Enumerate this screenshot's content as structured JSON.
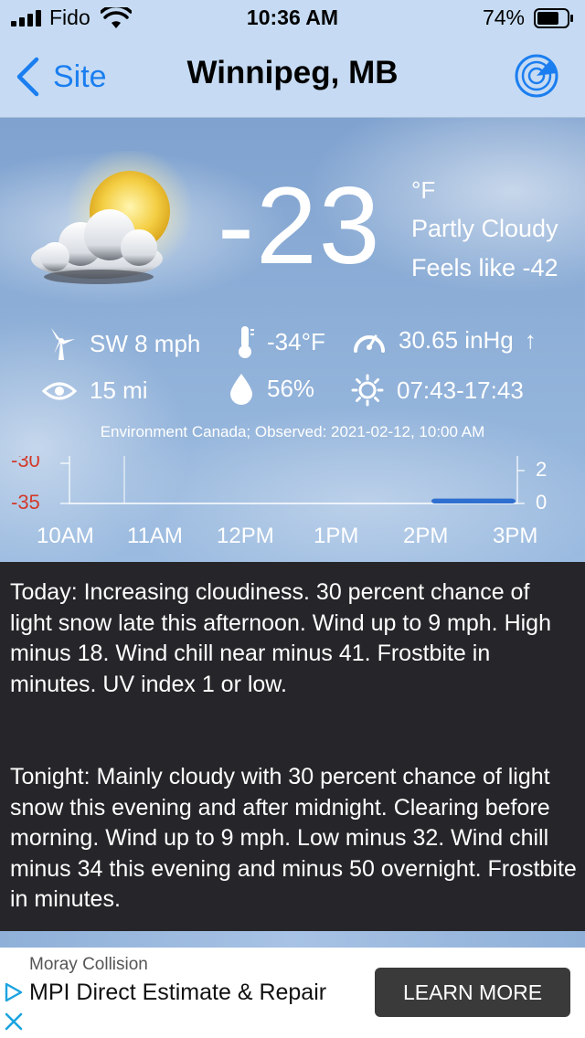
{
  "status_bar": {
    "carrier": "Fido",
    "time": "10:36 AM",
    "battery": "74%",
    "battery_level": 0.74,
    "icons": [
      "signal-icon",
      "wifi-icon",
      "battery-icon"
    ]
  },
  "nav": {
    "back_label": "Site",
    "title": "Winnipeg, MB",
    "icons": [
      "chevron-left-icon",
      "radar-icon"
    ]
  },
  "current": {
    "temperature": "-23",
    "unit": "°F",
    "condition": "Partly Cloudy",
    "feels_like": "Feels like -42",
    "wind": "SW 8 mph",
    "wind_chill": "-34°F",
    "pressure": "30.65 inHg",
    "pressure_trend": "↑",
    "visibility": "15 mi",
    "humidity": "56%",
    "sun_times": "07:43-17:43",
    "source": "Environment Canada; Observed: 2021-02-12, 10:00 AM",
    "icons": [
      "partly-cloudy-icon",
      "wind-turbine-icon",
      "thermometer-icon",
      "gauge-icon",
      "eye-icon",
      "droplet-icon",
      "sun-icon"
    ]
  },
  "chart": {
    "left_ticks": [
      "-30",
      "-35"
    ],
    "right_ticks": [
      "2",
      "0"
    ],
    "x_labels": [
      "10AM",
      "11AM",
      "12PM",
      "1PM",
      "2PM",
      "3PM"
    ]
  },
  "chart_data": {
    "type": "bar",
    "categories": [
      "10AM",
      "11AM",
      "12PM",
      "1PM",
      "2PM",
      "3PM"
    ],
    "series": [
      {
        "values": [
          0,
          0,
          0,
          0,
          0.3,
          0.3
        ]
      }
    ],
    "ylim": [
      0,
      2
    ]
  },
  "forecast": {
    "today": "Today:  Increasing cloudiness. 30 percent chance of light snow late this afternoon. Wind up to 9 mph. High minus 18. Wind chill near minus 41. Frostbite in minutes. UV index 1 or low.",
    "tonight": "Tonight:  Mainly cloudy with 30 percent chance of light snow this evening and after midnight. Clearing before morning. Wind up to 9 mph. Low minus 32. Wind chill minus 34 this evening and minus 50 overnight. Frostbite in minutes."
  },
  "ad": {
    "sponsor": "Moray Collision",
    "headline": "MPI Direct Estimate & Repair",
    "cta": "LEARN MORE",
    "icons": [
      "adchoices-icon",
      "close-icon"
    ]
  },
  "colors": {
    "accent": "#1b7ef0",
    "nav_bg": "#c6dbf3",
    "forecast_bg": "#26262a",
    "chart_left_axis": "#d23a2a",
    "precip_bar": "#2f6fd0"
  }
}
